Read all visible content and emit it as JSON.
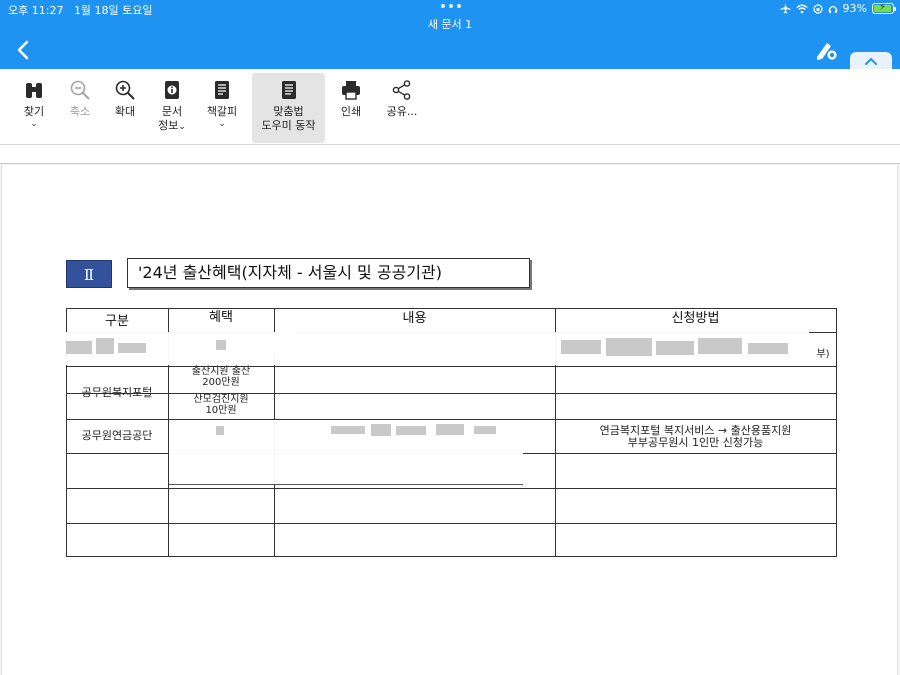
{
  "status": {
    "time": "오후 11:27",
    "date": "1월 18일 토요일",
    "battery_percent": "93%",
    "battery_level": 0.93
  },
  "header": {
    "document_title": "새 문서 1",
    "back_icon": "chevron-left-icon",
    "pen_icon": "pen-settings-icon",
    "collapse_icon": "chevron-up-icon",
    "color": "#1f93f2"
  },
  "toolbar": {
    "items": [
      {
        "label": "찾기",
        "icon": "binoculars-icon",
        "has_dropdown": true,
        "enabled": true
      },
      {
        "label": "축소",
        "icon": "zoom-out-icon",
        "has_dropdown": false,
        "enabled": false
      },
      {
        "label": "확대",
        "icon": "zoom-in-icon",
        "has_dropdown": false,
        "enabled": true
      },
      {
        "label_line1": "문서",
        "label_line2": "정보",
        "icon": "info-icon",
        "has_dropdown": true,
        "enabled": true
      },
      {
        "label": "책갈피",
        "icon": "bookmark-icon",
        "has_dropdown": true,
        "enabled": true
      },
      {
        "label_line1": "맞춤법",
        "label_line2": "도우미 동작",
        "icon": "spellcheck-doc-icon",
        "has_dropdown": false,
        "enabled": true,
        "active": true
      },
      {
        "label": "인쇄",
        "icon": "printer-icon",
        "has_dropdown": false,
        "enabled": true
      },
      {
        "label": "공유...",
        "icon": "share-icon",
        "has_dropdown": false,
        "enabled": true
      }
    ]
  },
  "document": {
    "section_number": "Ⅱ",
    "section_title": "'24년 출산혜택(지자체 - 서울시 및 공공기관)",
    "table": {
      "headers": [
        "구분",
        "혜택",
        "내용",
        "신청방법"
      ],
      "rows": [
        {
          "category": "",
          "benefit": "",
          "content": "",
          "method_suffix": "부)"
        },
        {
          "category": "공무원복지포털",
          "benefit_lines": [
            "출산지원 출산",
            "200만원"
          ],
          "content": "",
          "method": ""
        },
        {
          "category": "",
          "benefit_lines": [
            "산모검진지원",
            "10만원"
          ],
          "content": "",
          "method": ""
        },
        {
          "category": "공무원연금공단",
          "benefit": "",
          "content": "",
          "method_lines": [
            "연금복지포털 복지서비스 → 출산용품지원",
            "부부공무원시 1인만 신청가능"
          ]
        },
        {
          "category": "",
          "benefit": "",
          "content": "",
          "method": ""
        },
        {
          "category": "",
          "benefit": "",
          "content": "",
          "method": ""
        }
      ]
    }
  }
}
